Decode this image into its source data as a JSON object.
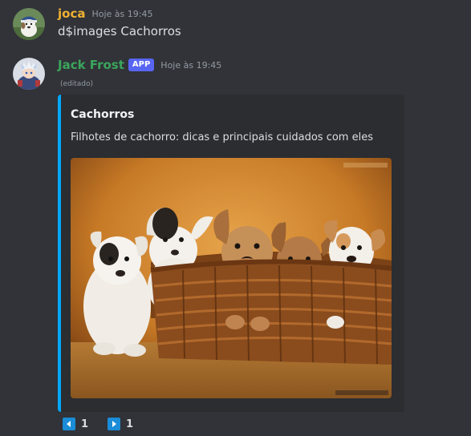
{
  "messages": [
    {
      "username": "joca",
      "timestamp": "Hoje às 19:45",
      "content": "d$images Cachorros",
      "avatar_icon": "dog-avatar-icon",
      "name_color": "#f0b232"
    },
    {
      "username": "Jack Frost",
      "badge": "APP",
      "timestamp": "Hoje às 19:45",
      "edited": "(editado)",
      "avatar_icon": "bot-avatar-icon",
      "name_color": "#3ba55c",
      "embed": {
        "title": "Cachorros",
        "description": "Filhotes de cachorro: dicas e principais cuidados com eles",
        "accent_color": "#00a8fc",
        "image": "puppies-in-basket-image"
      }
    }
  ],
  "pagination": {
    "prev": {
      "icon": "arrow-left-icon",
      "count": "1"
    },
    "next": {
      "icon": "arrow-right-icon",
      "count": "1"
    }
  }
}
